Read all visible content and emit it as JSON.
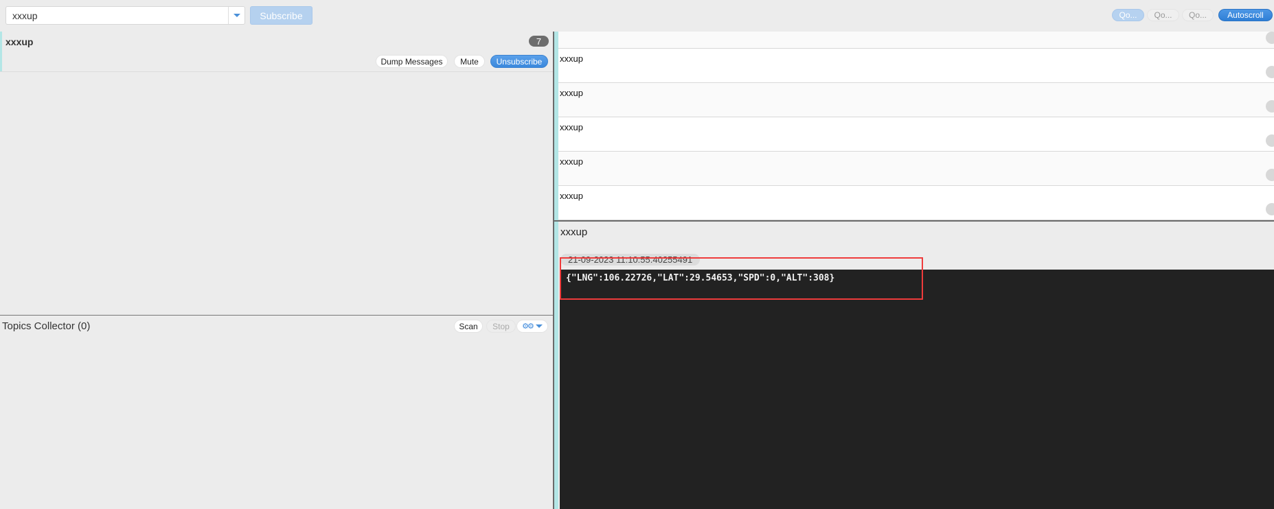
{
  "topbar": {
    "topic_input_value": "xxxup",
    "subscribe_label": "Subscribe",
    "qos_buttons": [
      "Qo...",
      "Qo...",
      "Qo..."
    ],
    "autoscroll_label": "Autoscroll"
  },
  "subscriptions": [
    {
      "topic": "xxxup",
      "count": "7",
      "buttons": {
        "dump": "Dump Messages",
        "mute": "Mute",
        "unsubscribe": "Unsubscribe"
      },
      "stripe_color": "#b3e6e6"
    }
  ],
  "topics_collector": {
    "title": "Topics Collector (0)",
    "scan_label": "Scan",
    "stop_label": "Stop",
    "settings_icon": "gears-icon"
  },
  "messages": [
    {
      "topic": ""
    },
    {
      "topic": "xxxup"
    },
    {
      "topic": "xxxup"
    },
    {
      "topic": "xxxup"
    },
    {
      "topic": "xxxup"
    },
    {
      "topic": "xxxup"
    }
  ],
  "detail": {
    "topic": "xxxup",
    "timestamp": "21-09-2023  11:10:55.40255491",
    "payload": "{\"LNG\":106.22726,\"LAT\":29.54653,\"SPD\":0,\"ALT\":308}"
  },
  "colors": {
    "accent_blue": "#3a88dc",
    "stripe_teal": "#b3e6e6",
    "payload_bg": "#222222",
    "highlight_red": "#ef3b3b"
  }
}
